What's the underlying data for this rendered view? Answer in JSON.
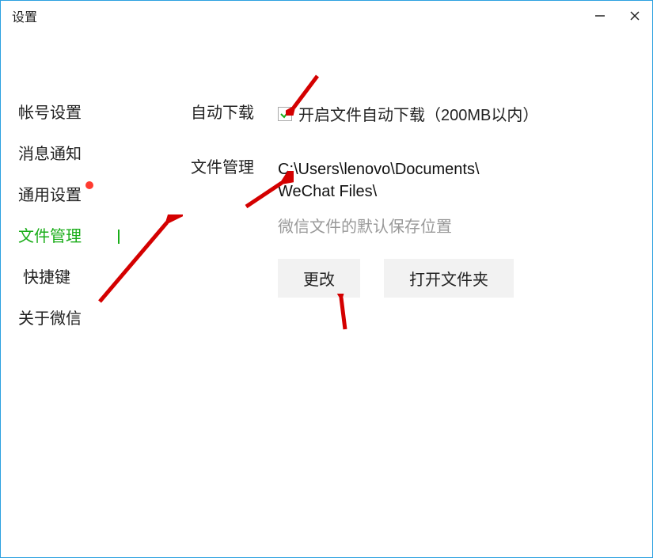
{
  "window": {
    "title": "设置"
  },
  "sidebar": {
    "items": [
      {
        "label": "帐号设置"
      },
      {
        "label": "消息通知"
      },
      {
        "label": "通用设置",
        "has_dot": true
      },
      {
        "label": "文件管理",
        "selected": true
      },
      {
        "label": "快捷键"
      },
      {
        "label": "关于微信"
      }
    ]
  },
  "content": {
    "auto_download": {
      "label": "自动下载",
      "checked": true,
      "text": "开启文件自动下载（200MB以内）"
    },
    "file_manage": {
      "label": "文件管理",
      "path_line1": "C:\\Users\\lenovo\\Documents\\",
      "path_line2": "WeChat Files\\",
      "hint": "微信文件的默认保存位置",
      "change_btn": "更改",
      "open_btn": "打开文件夹"
    }
  }
}
